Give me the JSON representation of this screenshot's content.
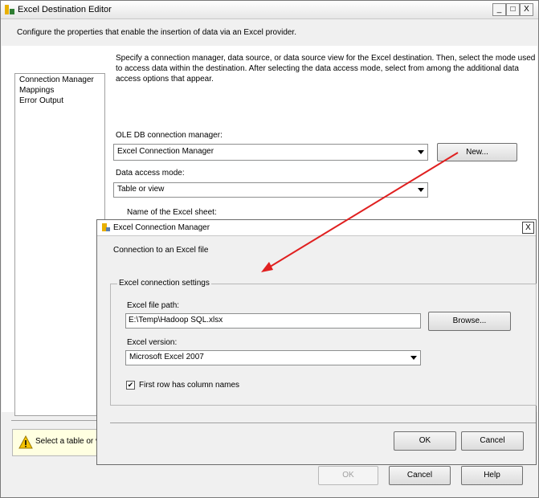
{
  "main_window": {
    "title": "Excel Destination Editor",
    "description": "Configure the properties that enable the insertion of data via an Excel provider.",
    "nav_items": [
      "Connection Manager",
      "Mappings",
      "Error Output"
    ],
    "instructions": [
      "Specify a connection manager, data source, or data source view for the Excel destination. Then, select the mode used",
      "to access data within the destination. After selecting the data access mode, select from among the additional data",
      "access options that appear."
    ],
    "oledb_label": "OLE DB connection manager:",
    "oledb_value": "Excel Connection Manager",
    "new_button": "New...",
    "access_mode_label": "Data access mode:",
    "access_mode_value": "Table or view",
    "sheet_label": "Name of the Excel sheet:",
    "warning_text": "Select a table or vie",
    "ok_button": "OK",
    "cancel_button": "Cancel",
    "help_button": "Help",
    "min_glyph": "_",
    "max_glyph": "□",
    "close_glyph": "X"
  },
  "dialog": {
    "title": "Excel Connection Manager",
    "subtitle": "Connection to an Excel file",
    "group_title": "Excel connection settings",
    "file_path_label": "Excel file path:",
    "file_path_value": "E:\\Temp\\Hadoop SQL.xlsx",
    "browse_button": "Browse...",
    "version_label": "Excel version:",
    "version_value": "Microsoft Excel 2007",
    "first_row_label": "First row has column names",
    "first_row_checked": true,
    "check_glyph": "✔",
    "ok_button": "OK",
    "cancel_button": "Cancel",
    "close_glyph": "X"
  },
  "colors": {
    "arrow": "#e02020",
    "warning": "#f5c400"
  }
}
